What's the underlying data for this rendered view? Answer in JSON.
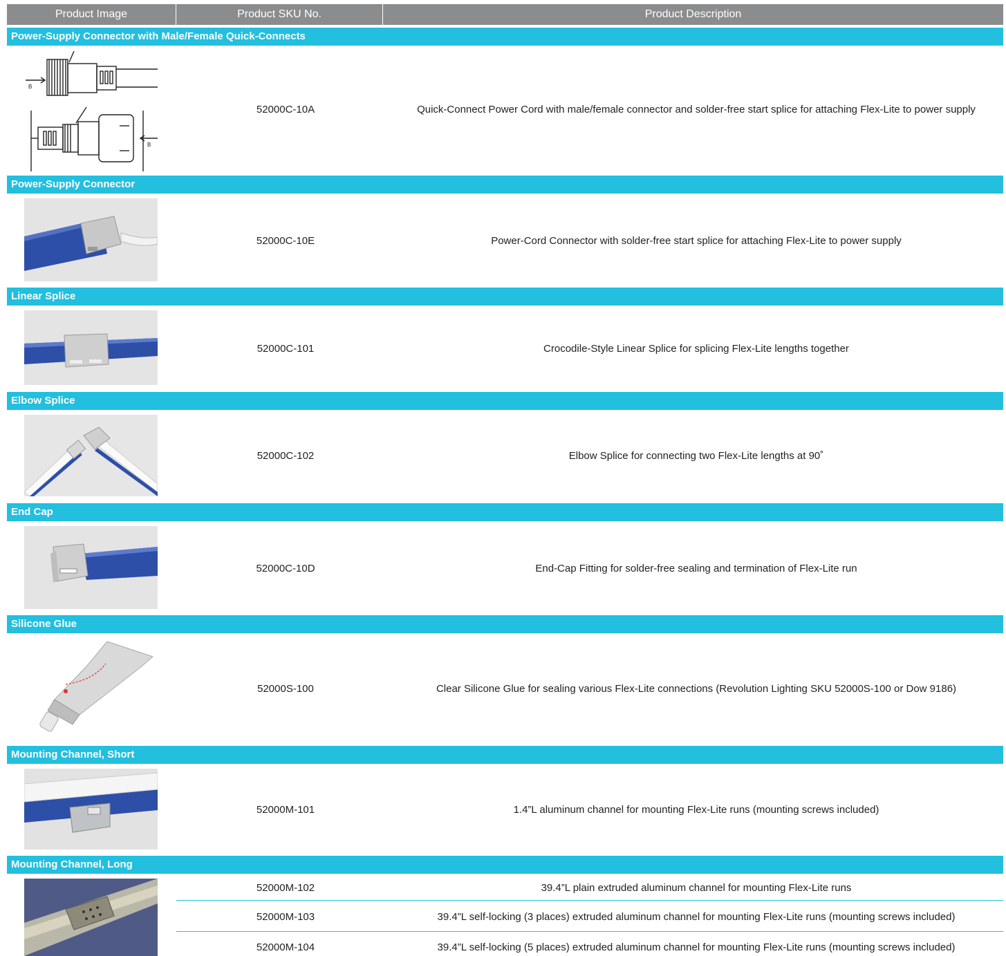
{
  "header": {
    "col_image": "Product Image",
    "col_sku": "Product SKU No.",
    "col_description": "Product Description"
  },
  "sections": [
    {
      "title": "Power-Supply Connector with Male/Female Quick-Connects",
      "image": "quick-connect-diagram",
      "items": [
        {
          "sku": "52000C-10A",
          "description": "Quick-Connect Power Cord with male/female connector and solder-free start splice for attaching Flex-Lite to power supply"
        }
      ]
    },
    {
      "title": "Power-Supply Connector",
      "image": "power-cord-connector-photo",
      "items": [
        {
          "sku": "52000C-10E",
          "description": "Power-Cord Connector with solder-free start splice for attaching Flex-Lite to power supply"
        }
      ]
    },
    {
      "title": "Linear Splice",
      "image": "linear-splice-photo",
      "items": [
        {
          "sku": "52000C-101",
          "description": "Crocodile-Style Linear Splice for splicing Flex-Lite lengths together"
        }
      ]
    },
    {
      "title": "Elbow Splice",
      "image": "elbow-splice-photo",
      "items": [
        {
          "sku": "52000C-102",
          "description": "Elbow Splice for connecting two Flex-Lite lengths at 90˚"
        }
      ]
    },
    {
      "title": "End Cap",
      "image": "end-cap-photo",
      "items": [
        {
          "sku": "52000C-10D",
          "description": "End-Cap Fitting for solder-free sealing and termination of Flex-Lite run"
        }
      ]
    },
    {
      "title": "Silicone Glue",
      "image": "silicone-glue-tube-photo",
      "items": [
        {
          "sku": "52000S-100",
          "description": "Clear Silicone Glue for sealing various Flex-Lite connections (Revolution Lighting SKU 52000S-100 or Dow 9186)"
        }
      ]
    },
    {
      "title": "Mounting Channel, Short",
      "image": "mounting-channel-short-photo",
      "items": [
        {
          "sku": "52000M-101",
          "description": "1.4”L aluminum channel for mounting Flex-Lite runs (mounting screws included)"
        }
      ]
    },
    {
      "title": "Mounting Channel, Long",
      "image": "mounting-channel-long-photo",
      "items": [
        {
          "sku": "52000M-102",
          "description": "39.4”L plain extruded aluminum channel for mounting Flex-Lite runs"
        },
        {
          "sku": "52000M-103",
          "description": "39.4”L self-locking (3 places) extruded aluminum channel for mounting Flex-Lite runs (mounting screws included)"
        },
        {
          "sku": "52000M-104",
          "description": "39.4”L self-locking (5 places) extruded aluminum channel for mounting Flex-Lite runs (mounting screws included)"
        }
      ]
    }
  ],
  "colors": {
    "header_bg": "#8a8c8e",
    "section_bg": "#22bfdf",
    "flex_lite_blue": "#2d4fa8"
  }
}
